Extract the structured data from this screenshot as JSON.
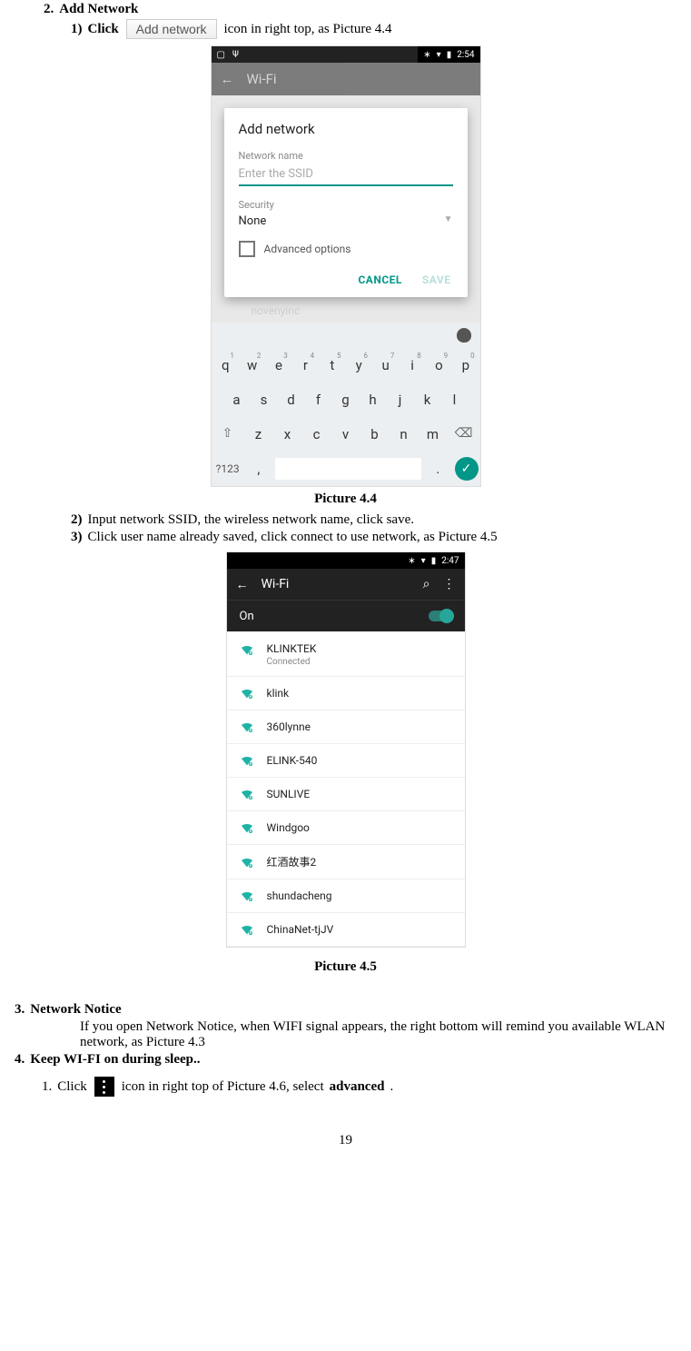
{
  "section2": {
    "num": "2.",
    "title": "Add Network"
  },
  "step1": {
    "num": "1)",
    "pre": "Click",
    "btn": "Add network",
    "post": "icon in right top, as Picture 4.4"
  },
  "ss44": {
    "time": "2:54",
    "back": "←",
    "title": "Wi-Fi",
    "dlg_title": "Add network",
    "label_name": "Network name",
    "placeholder_ssid": "Enter the SSID",
    "label_security": "Security",
    "security_value": "None",
    "advanced": "Advanced options",
    "cancel": "CANCEL",
    "save": "SAVE",
    "bg_text": "novenyinc",
    "row1": [
      {
        "k": "q",
        "n": "1"
      },
      {
        "k": "w",
        "n": "2"
      },
      {
        "k": "e",
        "n": "3"
      },
      {
        "k": "r",
        "n": "4"
      },
      {
        "k": "t",
        "n": "5"
      },
      {
        "k": "y",
        "n": "6"
      },
      {
        "k": "u",
        "n": "7"
      },
      {
        "k": "i",
        "n": "8"
      },
      {
        "k": "o",
        "n": "9"
      },
      {
        "k": "p",
        "n": "0"
      }
    ],
    "row2": [
      "a",
      "s",
      "d",
      "f",
      "g",
      "h",
      "j",
      "k",
      "l"
    ],
    "row3": [
      "z",
      "x",
      "c",
      "v",
      "b",
      "n",
      "m"
    ],
    "sym": "?123",
    "comma": ",",
    "dot": "."
  },
  "caption44": "Picture 4.4",
  "step2": {
    "num": "2)",
    "text": "Input network SSID, the wireless network name, click save."
  },
  "step3": {
    "num": "3)",
    "text": "Click user name already saved, click connect to use network, as Picture 4.5"
  },
  "ss45": {
    "time": "2:47",
    "back": "←",
    "title": "Wi-Fi",
    "on": "On",
    "networks": [
      {
        "name": "KLINKTEK",
        "sub": "Connected"
      },
      {
        "name": "klink"
      },
      {
        "name": "360lynne"
      },
      {
        "name": "ELINK-540"
      },
      {
        "name": "SUNLIVE"
      },
      {
        "name": "Windgoo"
      },
      {
        "name": "红酒故事2"
      },
      {
        "name": "shundacheng"
      },
      {
        "name": "ChinaNet-tjJV"
      }
    ]
  },
  "caption45": "Picture 4.5",
  "section3": {
    "num": "3.",
    "title": "Network Notice",
    "body": "If you open Network Notice, when WIFI signal appears, the right bottom will remind you available WLAN network, as Picture 4.3"
  },
  "section4": {
    "num": "4.",
    "title": "Keep WI-FI on during sleep.."
  },
  "sub1": {
    "num": "1.",
    "pre": "Click",
    "post": "icon in right top of Picture 4.6, select ",
    "bold": "advanced",
    "end": "."
  },
  "page": "19"
}
